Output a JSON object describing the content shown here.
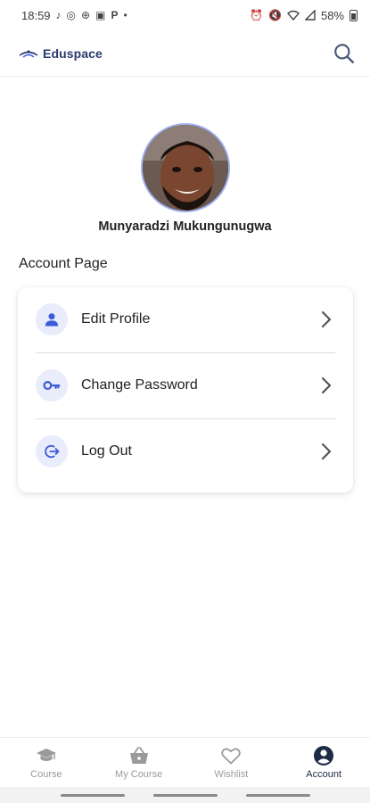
{
  "status_bar": {
    "time": "18:59",
    "left_icons": [
      "tiktok-icon",
      "whatsapp-icon",
      "download-icon",
      "notification-icon",
      "p-icon",
      "dot-icon"
    ],
    "battery_text": "58%"
  },
  "app_bar": {
    "brand": "Eduspace"
  },
  "profile": {
    "name": "Munyaradzi Mukungunugwa"
  },
  "section_title": "Account Page",
  "menu": {
    "items": [
      {
        "label": "Edit Profile",
        "icon": "person-icon"
      },
      {
        "label": "Change Password",
        "icon": "key-icon"
      },
      {
        "label": "Log Out",
        "icon": "logout-icon"
      }
    ]
  },
  "bottom_nav": {
    "items": [
      {
        "label": "Course",
        "icon": "graduation-cap-icon",
        "active": false
      },
      {
        "label": "My Course",
        "icon": "basket-icon",
        "active": false
      },
      {
        "label": "Wishlist",
        "icon": "heart-icon",
        "active": false
      },
      {
        "label": "Account",
        "icon": "account-circle-icon",
        "active": true
      }
    ]
  },
  "colors": {
    "accent": "#3d5bd9",
    "icon_bg": "#e8ecfb",
    "brand_text": "#2a3a6b",
    "nav_active": "#1f2a44",
    "nav_inactive": "#9a9a9a"
  }
}
